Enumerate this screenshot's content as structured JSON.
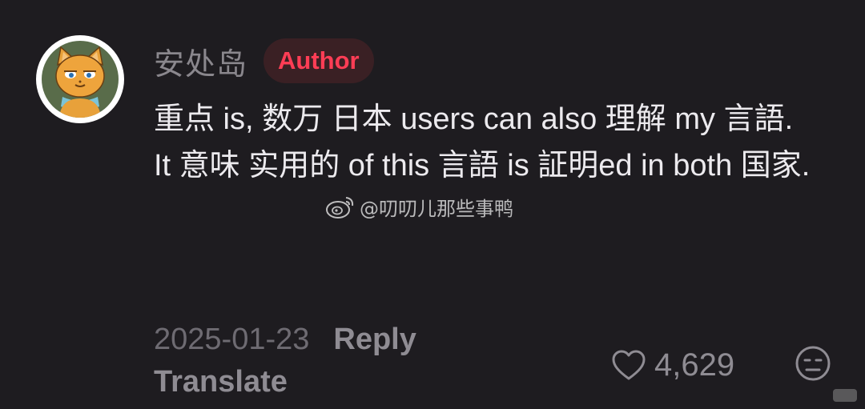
{
  "comment": {
    "username": "安处岛",
    "author_badge": "Author",
    "text_paragraphs": [
      "重点 is, 数万 日本 users can also 理解 my 言語.",
      "It 意味 实用的 of this 言語 is 証明ed in both 国家."
    ],
    "date": "2025-01-23",
    "reply_label": "Reply",
    "translate_label": "Translate",
    "like_count": "4,629"
  },
  "watermark": {
    "text": "@叨叨儿那些事鸭",
    "icon": "weibo-icon"
  },
  "icons": {
    "avatar": "cat-avatar",
    "like": "heart-outline-icon",
    "dislike": "neutral-face-icon"
  },
  "colors": {
    "background": "#1e1c20",
    "author_badge_text": "#ff3d55",
    "author_badge_bg": "#3a2024",
    "username": "#8a878d",
    "body_text": "#eceaee",
    "meta_text": "#8f8c93"
  }
}
